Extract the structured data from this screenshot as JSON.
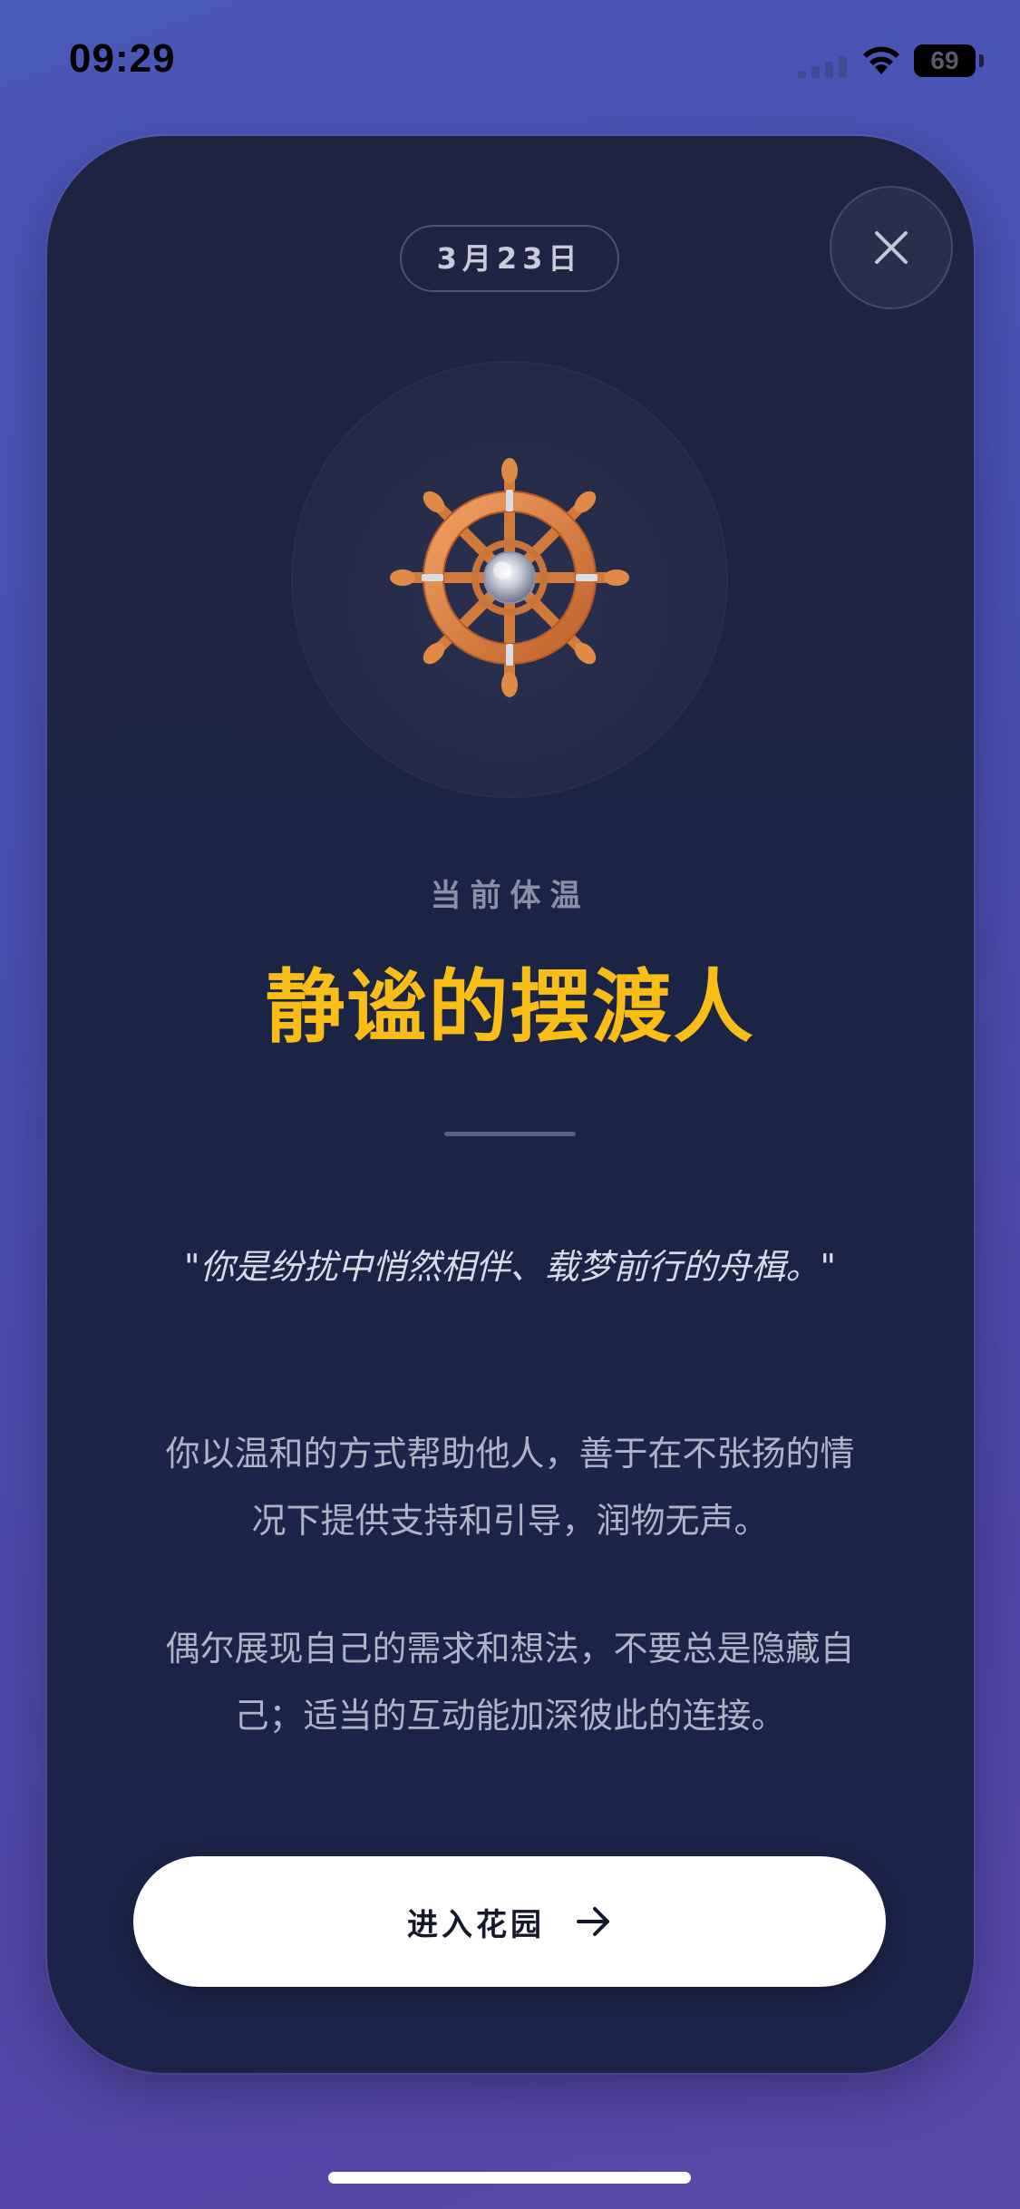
{
  "status_bar": {
    "time": "09:29",
    "battery_level": "69"
  },
  "card": {
    "date": "3月23日",
    "status_label": "当前体温",
    "title": "静谧的摆渡人",
    "quote": "\"你是纷扰中悄然相伴、载梦前行的舟楫。\"",
    "paragraphs": [
      "你以温和的方式帮助他人，善于在不张扬的情况下提供支持和引导，润物无声。",
      "偶尔展现自己的需求和想法，不要总是隐藏自己；适当的互动能加深彼此的连接。"
    ],
    "button_label": "进入花园",
    "emblem_icon": "ship-wheel-icon"
  },
  "colors": {
    "title": "#f8bd16",
    "card_background": "#1c2446",
    "page_background": "#4a52b0",
    "button_background": "#ffffff"
  }
}
